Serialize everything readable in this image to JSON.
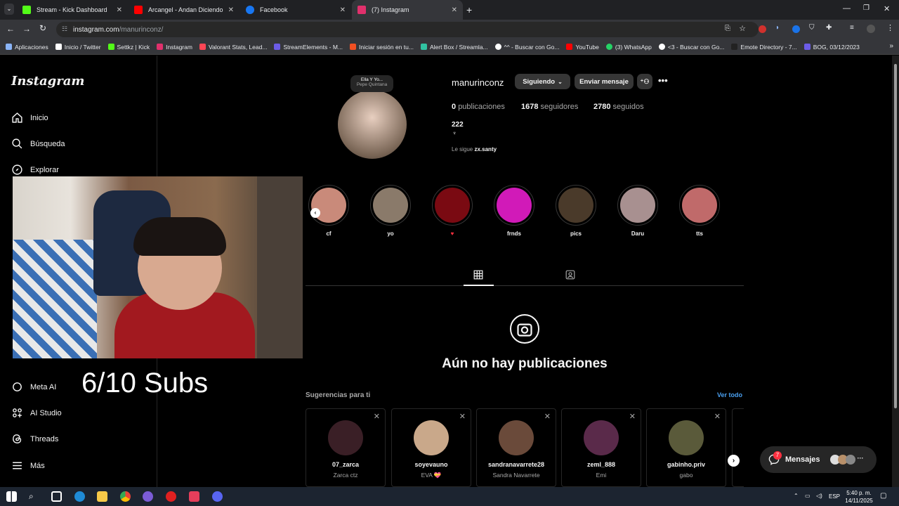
{
  "browser": {
    "tabs": [
      {
        "label": "Stream - Kick Dashboard",
        "color": "#53fc18"
      },
      {
        "label": "Arcangel - Andan Diciendo - Yo",
        "color": "#ff0000"
      },
      {
        "label": "Facebook",
        "color": "#1877f2"
      },
      {
        "label": "(7) Instagram",
        "color": "#e1306c"
      }
    ],
    "url_host": "instagram.com",
    "url_path": "/manurinconz/",
    "bookmarks": [
      {
        "label": "Aplicaciones",
        "color": "#8ab4f8"
      },
      {
        "label": "Inicio / Twitter",
        "color": "#ffffff"
      },
      {
        "label": "Settkz | Kick",
        "color": "#53fc18"
      },
      {
        "label": "Instagram",
        "color": "#e1306c"
      },
      {
        "label": "Valorant Stats, Lead...",
        "color": "#ff4655"
      },
      {
        "label": "StreamElements - M...",
        "color": "#6c5ce7"
      },
      {
        "label": "Iniciar sesión en tu...",
        "color": "#f25022"
      },
      {
        "label": "Alert Box / Streamla...",
        "color": "#31c3a2"
      },
      {
        "label": "^^ - Buscar con Go...",
        "color": "#ffffff"
      },
      {
        "label": "YouTube",
        "color": "#ff0000"
      },
      {
        "label": "(3) WhatsApp",
        "color": "#25d366"
      },
      {
        "label": "<3 - Buscar con Go...",
        "color": "#ffffff"
      },
      {
        "label": "Emote Directory - 7...",
        "color": "#222222"
      },
      {
        "label": "BOG, 03/12/2023",
        "color": "#6c5ce7"
      }
    ]
  },
  "sidebar": {
    "logo": "Instagram",
    "items_top": [
      "Inicio",
      "Búsqueda",
      "Explorar"
    ],
    "items_bottom": [
      "Meta AI",
      "AI Studio",
      "Threads",
      "Más"
    ]
  },
  "overlay": {
    "subs": "6/10 Subs"
  },
  "profile": {
    "note_title": "Ella Y Yo...",
    "note_artist": "Pepe Quintana",
    "username": "manurinconz",
    "follow_btn": "Siguiendo",
    "message_btn": "Enviar mensaje",
    "posts_count": "0",
    "posts_label": "publicaciones",
    "followers_count": "1678",
    "followers_label": "seguidores",
    "following_count": "2780",
    "following_label": "seguidos",
    "name": "222",
    "followed_by_prefix": "Le sigue",
    "followed_by_user": "zx.santy"
  },
  "highlights": [
    {
      "label": "cf",
      "color": "#c98a7a"
    },
    {
      "label": "yo",
      "color": "#8a7a6a"
    },
    {
      "label": "♥",
      "color": "#7a0a12"
    },
    {
      "label": "frnds",
      "color": "#d11ab8"
    },
    {
      "label": "pics",
      "color": "#4a3a2a"
    },
    {
      "label": "Daru",
      "color": "#a89090"
    },
    {
      "label": "tts",
      "color": "#c06a6a"
    }
  ],
  "empty_state": "Aún no hay publicaciones",
  "suggestions": {
    "title": "Sugerencias para ti",
    "see_all": "Ver todo",
    "cards": [
      {
        "user": "07_zarca",
        "name": "Zarca ctz",
        "color": "#3a1f26"
      },
      {
        "user": "soyevauno",
        "name": "EVA 💝",
        "color": "#c9a88a"
      },
      {
        "user": "sandranavarrete28",
        "name": "Sandra Navarrete",
        "color": "#6a4a3a"
      },
      {
        "user": "zeml_888",
        "name": "Emi",
        "color": "#5a2a4a"
      },
      {
        "user": "gabinho.priv",
        "name": "gabo",
        "color": "#5a5a3a"
      }
    ]
  },
  "messages": {
    "label": "Mensajes",
    "badge": "7"
  },
  "taskbar": {
    "lang": "ESP",
    "time": "5:40 p. m.",
    "date": "14/11/2025"
  }
}
